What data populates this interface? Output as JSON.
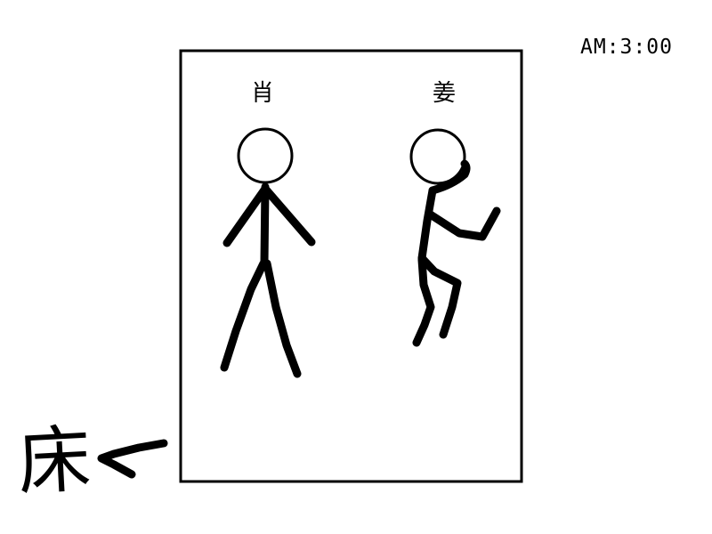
{
  "time": "AM:3:00",
  "figures": {
    "left_name": "肖",
    "right_name": "姜"
  },
  "floor": {
    "label": "床"
  }
}
